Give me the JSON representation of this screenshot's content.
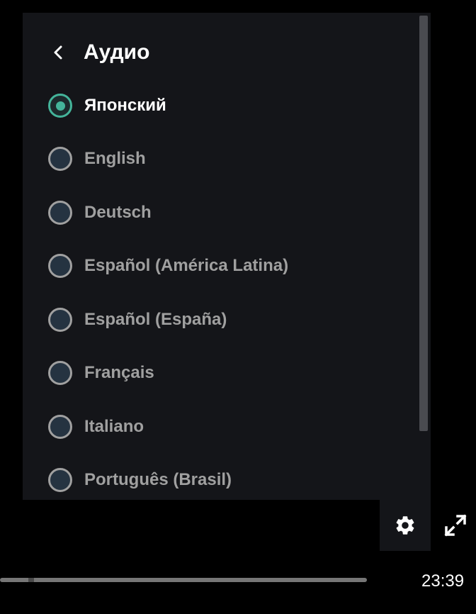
{
  "menu": {
    "title": "Аудио",
    "options": [
      {
        "label": "Японский",
        "selected": true
      },
      {
        "label": "English",
        "selected": false
      },
      {
        "label": "Deutsch",
        "selected": false
      },
      {
        "label": "Español (América Latina)",
        "selected": false
      },
      {
        "label": "Español (España)",
        "selected": false
      },
      {
        "label": "Français",
        "selected": false
      },
      {
        "label": "Italiano",
        "selected": false
      },
      {
        "label": "Português (Brasil)",
        "selected": false
      }
    ]
  },
  "player": {
    "time": "23:39",
    "icons": [
      "chevron-left-icon",
      "gear-icon",
      "fullscreen-icon"
    ]
  },
  "colors": {
    "accent": "#44b49a",
    "panel": "#141519",
    "radio_fill": "#253341",
    "text_muted": "#a0a0a0"
  }
}
